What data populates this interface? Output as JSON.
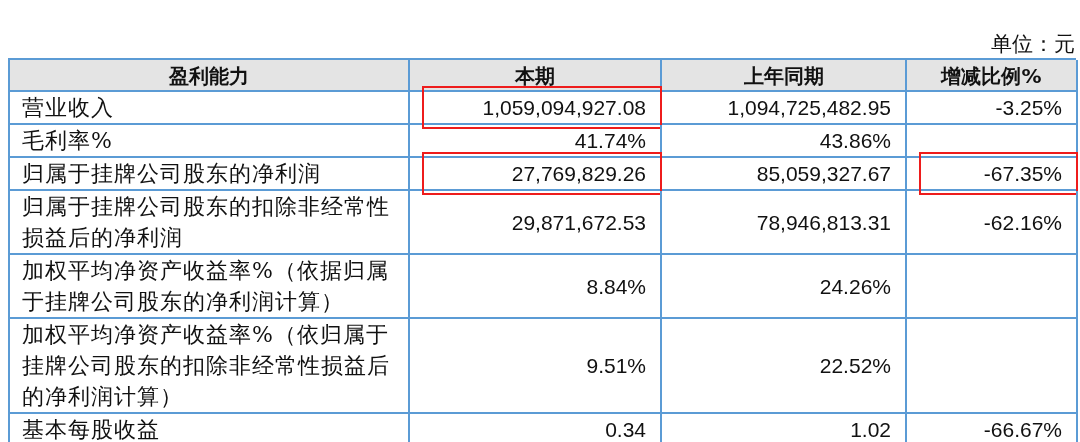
{
  "unit_label": "单位：元",
  "table": {
    "columns": [
      "盈利能力",
      "本期",
      "上年同期",
      "增减比例%"
    ],
    "rows": [
      {
        "label": "营业收入",
        "current": {
          "text": "1,059,094,927.08",
          "highlighted": true
        },
        "prior": "1,094,725,482.95",
        "change": {
          "text": "-3.25%",
          "highlighted": false
        }
      },
      {
        "label": "毛利率%",
        "current": {
          "text": "41.74%",
          "highlighted": false
        },
        "prior": "43.86%"
      },
      {
        "label": "归属于挂牌公司股东的净利润",
        "current": {
          "text": "27,769,829.26",
          "highlighted": true
        },
        "prior": "85,059,327.67",
        "change": {
          "text": "-67.35%",
          "highlighted": true
        }
      },
      {
        "label": "归属于挂牌公司股东的扣除非经常性损益后的净利润",
        "current": {
          "text": "29,871,672.53",
          "highlighted": false
        },
        "prior": "78,946,813.31",
        "change": {
          "text": "-62.16%",
          "highlighted": false
        }
      },
      {
        "label": "加权平均净资产收益率%（依据归属于挂牌公司股东的净利润计算）",
        "current": {
          "text": "8.84%",
          "highlighted": false
        },
        "prior": "24.26%"
      },
      {
        "label": "加权平均净资产收益率%（依归属于挂牌公司股东的扣除非经常性损益后的净利润计算）",
        "current": {
          "text": "9.51%",
          "highlighted": false
        },
        "prior": "22.52%"
      },
      {
        "label": "基本每股收益",
        "current": {
          "text": "0.34",
          "highlighted": false
        },
        "prior": "1.02",
        "change": {
          "text": "-66.67%",
          "highlighted": false
        }
      }
    ]
  }
}
